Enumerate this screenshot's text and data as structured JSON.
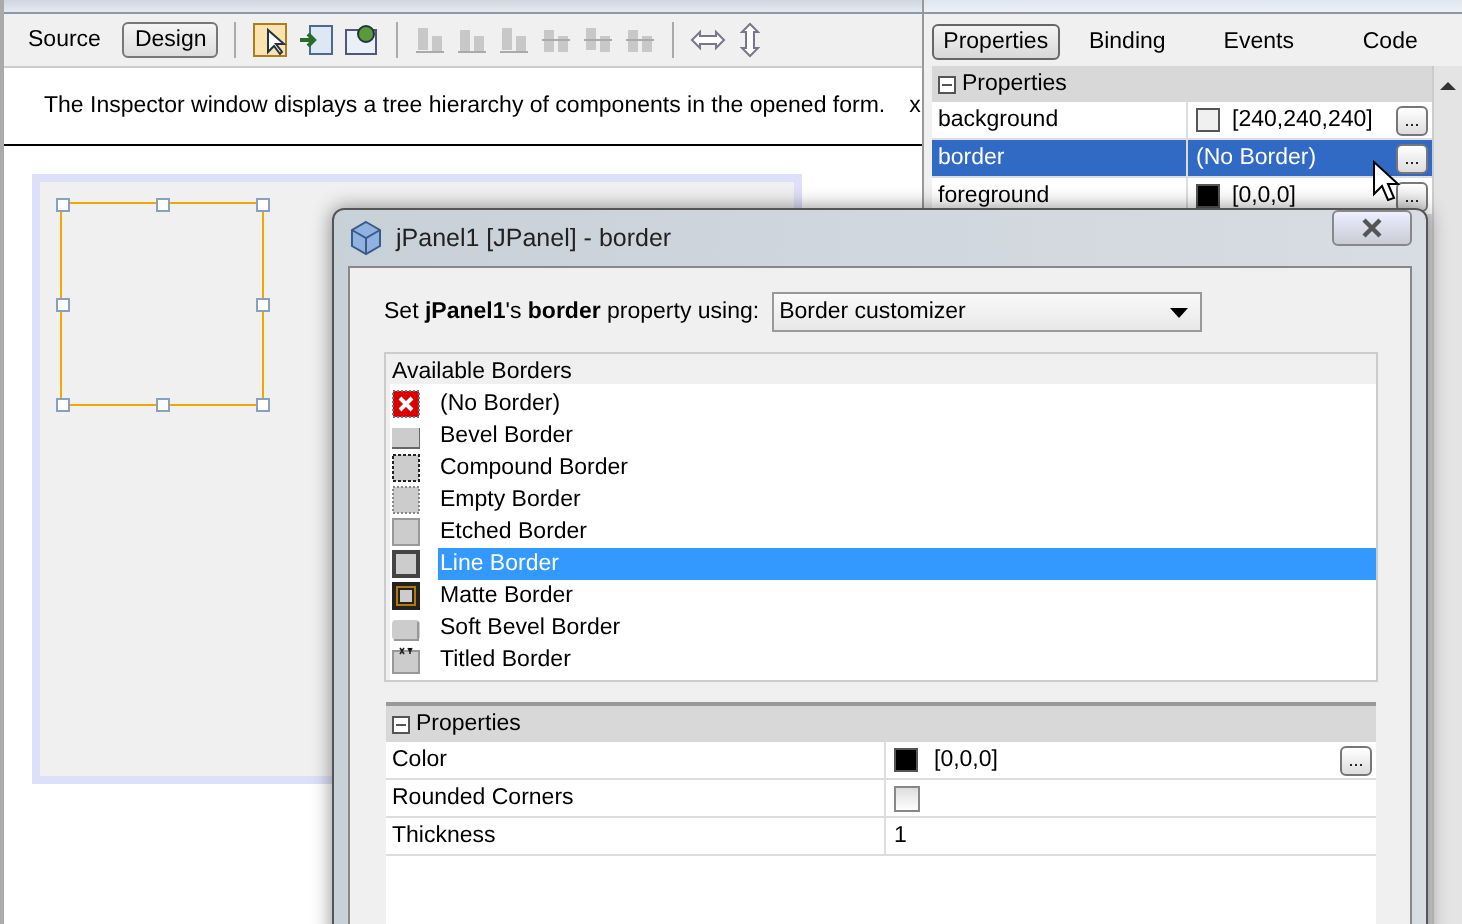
{
  "editor": {
    "view_tabs": [
      {
        "label": "Source",
        "selected": false
      },
      {
        "label": "Design",
        "selected": true
      }
    ],
    "hint": {
      "text": "The Inspector window displays a tree hierarchy of components in the opened form.",
      "close": "x"
    }
  },
  "properties_panel": {
    "tabs": [
      {
        "label": "Properties",
        "selected": true
      },
      {
        "label": "Binding",
        "selected": false
      },
      {
        "label": "Events",
        "selected": false
      },
      {
        "label": "Code",
        "selected": false
      }
    ],
    "section": "Properties",
    "rows": [
      {
        "name": "background",
        "value": "[240,240,240]",
        "color": "#f0f0f0",
        "selected": false,
        "action": "..."
      },
      {
        "name": "border",
        "value": "(No Border)",
        "selected": true,
        "action": "..."
      },
      {
        "name": "foreground",
        "value": "[0,0,0]",
        "color": "#000000",
        "selected": false,
        "action": "..."
      }
    ]
  },
  "dialog": {
    "title": "jPanel1 [JPanel] - border",
    "prompt": "Set **jPanel1**'s **border** property using:",
    "editor_choice": "Border customizer",
    "borders_label": "Available Borders",
    "borders": [
      {
        "label": "(No Border)",
        "kind": "none",
        "selected": false
      },
      {
        "label": "Bevel Border",
        "kind": "bevel",
        "selected": false
      },
      {
        "label": "Compound Border",
        "kind": "compound",
        "selected": false
      },
      {
        "label": "Empty Border",
        "kind": "empty",
        "selected": false
      },
      {
        "label": "Etched Border",
        "kind": "etched",
        "selected": false
      },
      {
        "label": "Line Border",
        "kind": "line",
        "selected": true
      },
      {
        "label": "Matte Border",
        "kind": "matte",
        "selected": false
      },
      {
        "label": "Soft Bevel Border",
        "kind": "softbevel",
        "selected": false
      },
      {
        "label": "Titled Border",
        "kind": "titled",
        "selected": false
      }
    ],
    "properties_section": "Properties",
    "properties": [
      {
        "name": "Color",
        "kind": "color",
        "value": "[0,0,0]",
        "color": "#000000",
        "action": "..."
      },
      {
        "name": "Rounded Corners",
        "kind": "checkbox",
        "checked": false
      },
      {
        "name": "Thickness",
        "kind": "text",
        "value": "1"
      }
    ]
  }
}
